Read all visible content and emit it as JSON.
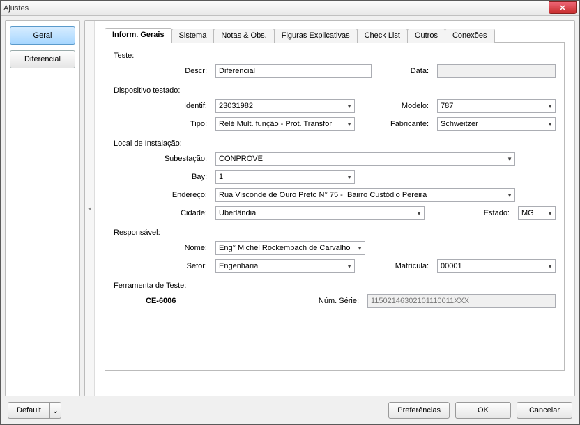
{
  "window": {
    "title": "Ajustes"
  },
  "sidebar": {
    "geral": "Geral",
    "diferencial": "Diferencial"
  },
  "tabs": {
    "inform_gerais": "Inform. Gerais",
    "sistema": "Sistema",
    "notas_obs": "Notas & Obs.",
    "figuras": "Figuras Explicativas",
    "check_list": "Check List",
    "outros": "Outros",
    "conexoes": "Conexões"
  },
  "sections": {
    "teste": "Teste:",
    "dispositivo": "Dispositivo testado:",
    "local": "Local de Instalação:",
    "responsavel": "Responsável:",
    "ferramenta": "Ferramenta de Teste:"
  },
  "labels": {
    "descr": "Descr:",
    "data": "Data:",
    "identif": "Identif:",
    "modelo": "Modelo:",
    "tipo": "Tipo:",
    "fabricante": "Fabricante:",
    "subestacao": "Subestação:",
    "bay": "Bay:",
    "endereco": "Endereço:",
    "cidade": "Cidade:",
    "estado": "Estado:",
    "nome": "Nome:",
    "setor": "Setor:",
    "matricula": "Matrícula:",
    "num_serie": "Núm. Série:"
  },
  "values": {
    "descr": "Diferencial",
    "data": "",
    "identif": "23031982",
    "modelo": "787",
    "tipo": "Relé Mult. função - Prot. Transfor",
    "fabricante": "Schweitzer",
    "subestacao": "CONPROVE",
    "bay": "1",
    "endereco": "Rua Visconde de Ouro Preto N° 75 -  Bairro Custódio Pereira",
    "cidade": "Uberlândia",
    "estado": "MG",
    "nome": "Eng° Michel Rockembach de Carvalho",
    "setor": "Engenharia",
    "matricula": "00001",
    "ferramenta_modelo": "CE-6006",
    "num_serie": "11502146302101110011XXX"
  },
  "footer": {
    "default": "Default",
    "preferencias": "Preferências",
    "ok": "OK",
    "cancelar": "Cancelar"
  }
}
